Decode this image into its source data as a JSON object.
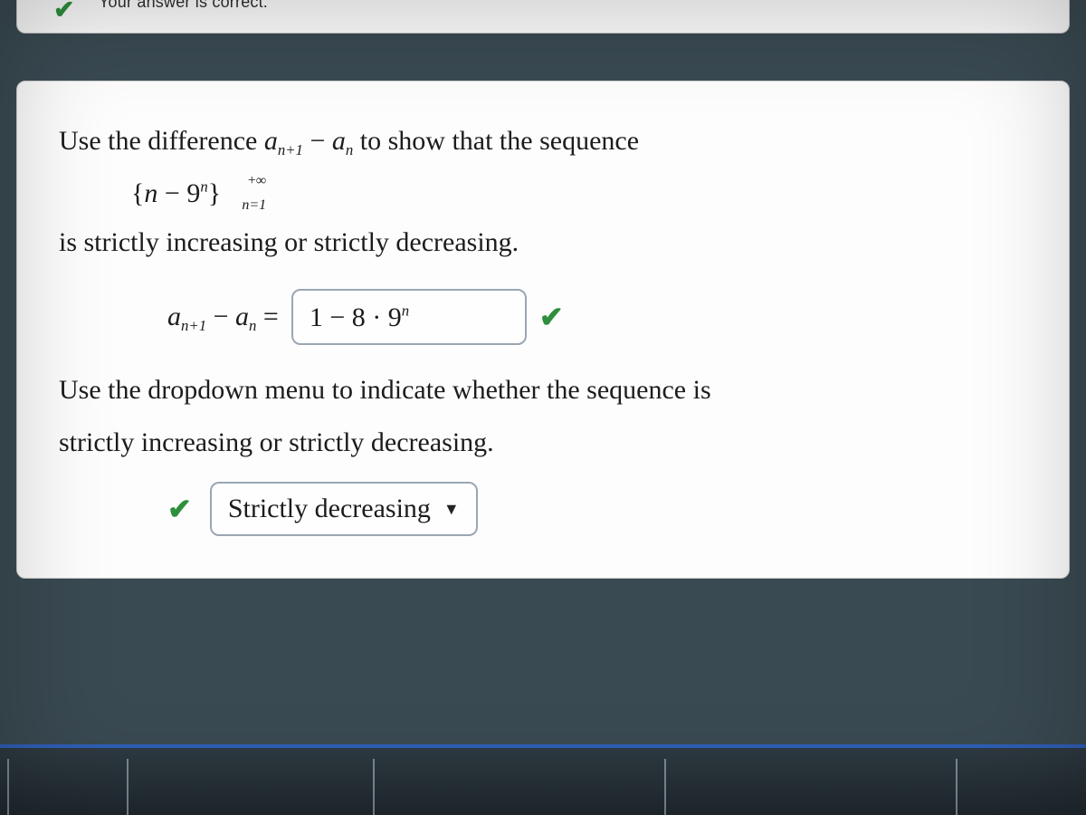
{
  "banner": {
    "status_text": "Your answer is correct."
  },
  "question": {
    "prompt_prefix": "Use the difference ",
    "prompt_diff_a": "a",
    "prompt_diff_sub1": "n+1",
    "prompt_diff_minus": " − ",
    "prompt_diff_b": "a",
    "prompt_diff_sub2": "n",
    "prompt_suffix": " to show that the sequence",
    "sequence_open": "{",
    "sequence_body_n": "n",
    "sequence_body_minus": " − ",
    "sequence_body_9": "9",
    "sequence_body_exp": "n",
    "sequence_close": "}",
    "sequence_upper": "+∞",
    "sequence_lower": "n=1",
    "prompt_line2": "is strictly increasing or strictly decreasing.",
    "answer_lhs_a": "a",
    "answer_lhs_sub1": "n+1",
    "answer_lhs_minus": " − ",
    "answer_lhs_b": "a",
    "answer_lhs_sub2": "n",
    "answer_lhs_eq": " = ",
    "answer_value": "1 − 8 · 9",
    "answer_value_exp": "n",
    "prompt2_line1": "Use the dropdown menu to indicate whether the sequence is",
    "prompt2_line2": "strictly increasing or strictly decreasing.",
    "dropdown_selected": "Strictly decreasing"
  }
}
